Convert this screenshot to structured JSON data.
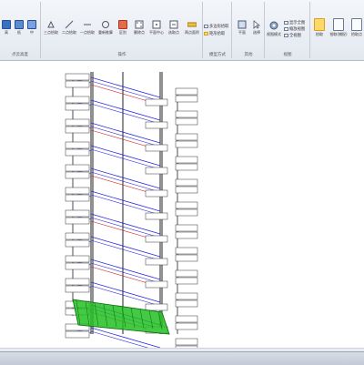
{
  "ribbon": {
    "groups": [
      {
        "label": "点云高度",
        "tools": [
          "高",
          "低",
          "中"
        ]
      },
      {
        "label": "操作",
        "tools": [
          "三点拾取",
          "二点拾取",
          "一点拾取",
          "重新推算",
          "区别",
          "删除点",
          "平面中心",
          "选取点",
          "两点面积"
        ]
      },
      {
        "label": "模型方式",
        "tools": [
          "多边形拾取",
          "矩形拾取"
        ]
      },
      {
        "label": "其他",
        "tools": [
          "平面",
          "选择"
        ]
      },
      {
        "label": "视图",
        "tools": [
          "视图模式",
          "显示全图",
          "缩放视图",
          "全视图"
        ]
      },
      {
        "label": "",
        "tools": [
          "拾取",
          "拾取(捕捉)",
          "拾取点"
        ]
      }
    ]
  },
  "icons": [
    "gear-icon",
    "select-icon"
  ],
  "colors": {
    "ribbon_bg": "#e3e8f0",
    "accent": "#ffd86a",
    "line_blue": "#2a2ae0",
    "line_red": "#d02020",
    "green": "#22c022"
  }
}
